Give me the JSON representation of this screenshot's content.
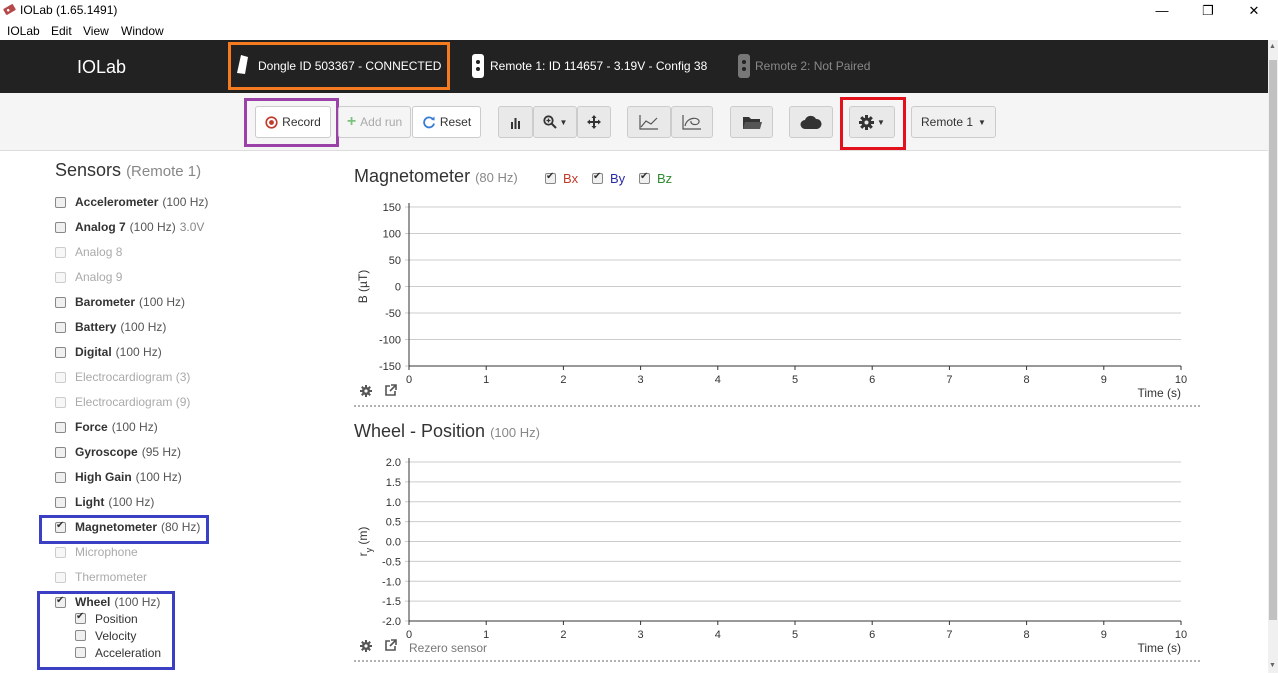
{
  "window": {
    "title": "IOLab (1.65.1491)",
    "minimize": "—",
    "restore": "❐",
    "close": "✕"
  },
  "menu": [
    "IOLab",
    "Edit",
    "View",
    "Window"
  ],
  "header": {
    "brand": "IOLab",
    "dongle": "Dongle ID 503367 - CONNECTED",
    "remote1": "Remote 1: ID 114657 - 3.19V - Config 38",
    "remote2": "Remote 2: Not Paired"
  },
  "toolbar": {
    "record": "Record",
    "add_run": "Add run",
    "reset": "Reset",
    "remote_select": "Remote 1"
  },
  "sidebar": {
    "title": "Sensors",
    "subtitle": "(Remote 1)",
    "sensors": [
      {
        "name": "Accelerometer",
        "rate": "(100 Hz)",
        "extra": "",
        "enabled": true,
        "checked": false
      },
      {
        "name": "Analog 7",
        "rate": "(100 Hz)",
        "extra": "3.0V",
        "enabled": true,
        "checked": false
      },
      {
        "name": "Analog 8",
        "rate": "",
        "extra": "",
        "enabled": false,
        "checked": false
      },
      {
        "name": "Analog 9",
        "rate": "",
        "extra": "",
        "enabled": false,
        "checked": false
      },
      {
        "name": "Barometer",
        "rate": "(100 Hz)",
        "extra": "",
        "enabled": true,
        "checked": false
      },
      {
        "name": "Battery",
        "rate": "(100 Hz)",
        "extra": "",
        "enabled": true,
        "checked": false
      },
      {
        "name": "Digital",
        "rate": "(100 Hz)",
        "extra": "",
        "enabled": true,
        "checked": false
      },
      {
        "name": "Electrocardiogram (3)",
        "rate": "",
        "extra": "",
        "enabled": false,
        "checked": false
      },
      {
        "name": "Electrocardiogram (9)",
        "rate": "",
        "extra": "",
        "enabled": false,
        "checked": false
      },
      {
        "name": "Force",
        "rate": "(100 Hz)",
        "extra": "",
        "enabled": true,
        "checked": false
      },
      {
        "name": "Gyroscope",
        "rate": "(95 Hz)",
        "extra": "",
        "enabled": true,
        "checked": false
      },
      {
        "name": "High Gain",
        "rate": "(100 Hz)",
        "extra": "",
        "enabled": true,
        "checked": false
      },
      {
        "name": "Light",
        "rate": "(100 Hz)",
        "extra": "",
        "enabled": true,
        "checked": false
      },
      {
        "name": "Magnetometer",
        "rate": "(80 Hz)",
        "extra": "",
        "enabled": true,
        "checked": true
      },
      {
        "name": "Microphone",
        "rate": "",
        "extra": "",
        "enabled": false,
        "checked": false
      },
      {
        "name": "Thermometer",
        "rate": "",
        "extra": "",
        "enabled": false,
        "checked": false
      },
      {
        "name": "Wheel",
        "rate": "(100 Hz)",
        "extra": "",
        "enabled": true,
        "checked": true
      }
    ],
    "wheel_sub": [
      {
        "label": "Position",
        "checked": true
      },
      {
        "label": "Velocity",
        "checked": false
      },
      {
        "label": "Acceleration",
        "checked": false
      }
    ]
  },
  "charts": {
    "mag": {
      "title": "Magnetometer",
      "rate": "(80 Hz)",
      "legend": [
        {
          "label": "Bx",
          "color": "#c0392b"
        },
        {
          "label": "By",
          "color": "#2c2ca8"
        },
        {
          "label": "Bz",
          "color": "#2e8b2e"
        }
      ]
    },
    "wheel": {
      "title": "Wheel - Position",
      "rate": "(100 Hz)",
      "rezero": "Rezero sensor"
    }
  },
  "chart_data": [
    {
      "type": "line",
      "title": "Magnetometer",
      "xlabel": "Time (s)",
      "ylabel": "B (µT)",
      "xlim": [
        0,
        10
      ],
      "ylim": [
        -150,
        150
      ],
      "xticks": [
        "0",
        "1",
        "2",
        "3",
        "4",
        "5",
        "6",
        "7",
        "8",
        "9",
        "10"
      ],
      "yticks": [
        "150",
        "100",
        "50",
        "0",
        "-50",
        "-100",
        "-150"
      ],
      "series": [
        {
          "name": "Bx",
          "values": []
        },
        {
          "name": "By",
          "values": []
        },
        {
          "name": "Bz",
          "values": []
        }
      ],
      "grid": true
    },
    {
      "type": "line",
      "title": "Wheel - Position",
      "xlabel": "Time (s)",
      "ylabel": "r_y (m)",
      "xlim": [
        0,
        10
      ],
      "ylim": [
        -2.0,
        2.0
      ],
      "xticks": [
        "0",
        "1",
        "2",
        "3",
        "4",
        "5",
        "6",
        "7",
        "8",
        "9",
        "10"
      ],
      "yticks": [
        "2.0",
        "1.5",
        "1.0",
        "0.5",
        "0.0",
        "-0.5",
        "-1.0",
        "-1.5",
        "-2.0"
      ],
      "series": [],
      "grid": true
    }
  ],
  "highlight_colors": {
    "orange": "#f47b20",
    "purple": "#9b42a8",
    "red": "#e3111b",
    "blue": "#3a3fc4"
  }
}
